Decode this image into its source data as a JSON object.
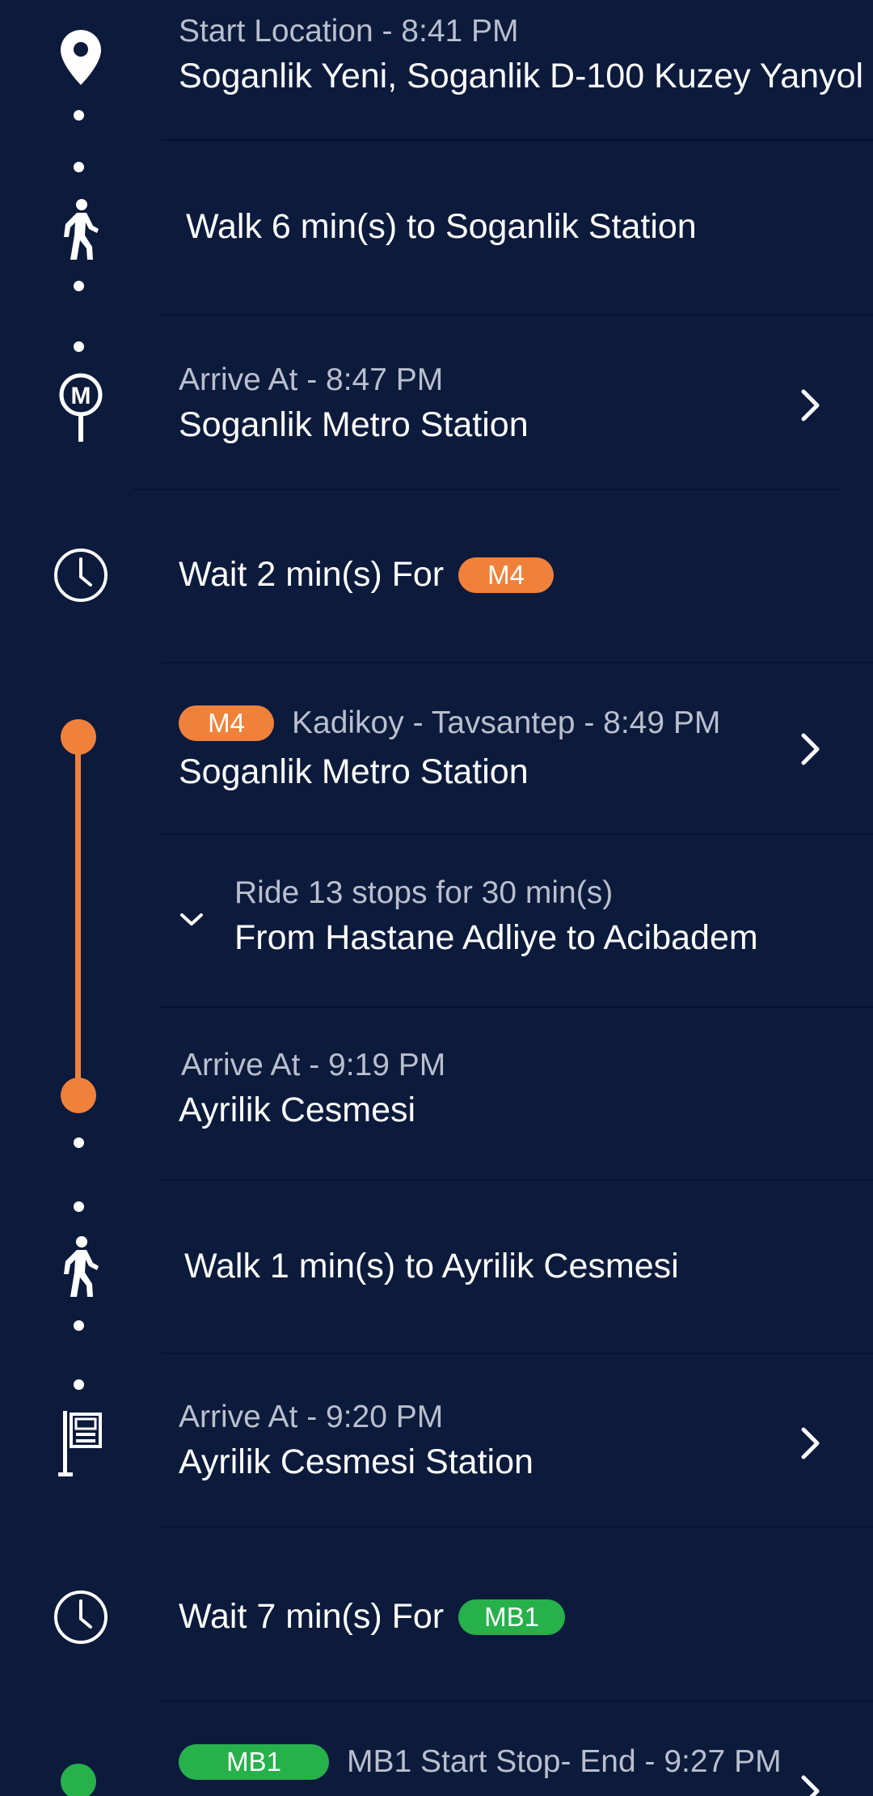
{
  "colors": {
    "background": "#0c1a3c",
    "divider": "#07122b",
    "secondary_text": "#b9bfcc",
    "line_m4": "#f0813a",
    "line_mb1": "#26b14b"
  },
  "steps": {
    "start": {
      "subtitle": "Start Location - 8:41 PM",
      "title": "Soganlik Yeni, Soganlik D-100 Kuzey Yanyol",
      "icon": "location-pin-icon"
    },
    "walk1": {
      "text": "Walk 6 min(s) to Soganlik Station",
      "icon": "walking-person-icon"
    },
    "arrive1": {
      "subtitle": "Arrive At - 8:47 PM",
      "title": "Soganlik Metro Station",
      "icon": "metro-station-icon"
    },
    "wait1": {
      "text": "Wait 2 min(s) For",
      "line": "M4",
      "icon": "clock-icon"
    },
    "board1": {
      "line": "M4",
      "route": "Kadikoy - Tavsantep - 8:49 PM",
      "title": "Soganlik Metro Station"
    },
    "ride1": {
      "subtitle": "Ride 13 stops for 30 min(s)",
      "title": "From Hastane Adliye to Acibadem",
      "icon": "chevron-down-icon"
    },
    "arrive2": {
      "subtitle": "Arrive At - 9:19 PM",
      "title": "Ayrilik Cesmesi"
    },
    "walk2": {
      "text": "Walk 1 min(s) to Ayrilik Cesmesi",
      "icon": "walking-person-icon"
    },
    "arrive3": {
      "subtitle": "Arrive At - 9:20 PM",
      "title": "Ayrilik Cesmesi Station",
      "icon": "bus-stop-icon"
    },
    "wait2": {
      "text": "Wait 7 min(s) For",
      "line": "MB1",
      "icon": "clock-icon"
    },
    "board2": {
      "line": "MB1",
      "route": "MB1 Start Stop- End - 9:27 PM"
    }
  }
}
